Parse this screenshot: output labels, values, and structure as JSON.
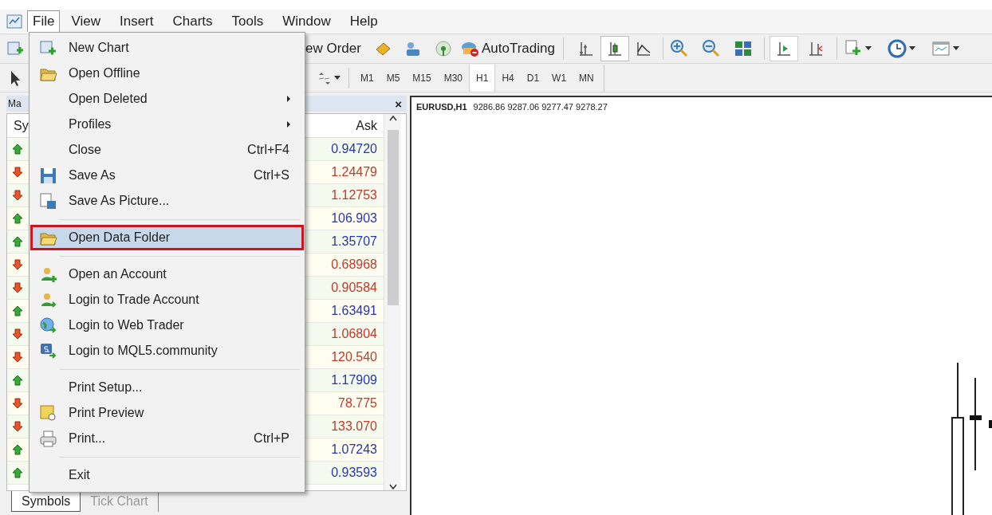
{
  "menu_bar": [
    {
      "label": "File",
      "selected": true
    },
    {
      "label": "View",
      "selected": false
    },
    {
      "label": "Insert",
      "selected": false
    },
    {
      "label": "Charts",
      "selected": false
    },
    {
      "label": "Tools",
      "selected": false
    },
    {
      "label": "Window",
      "selected": false
    },
    {
      "label": "Help",
      "selected": false
    }
  ],
  "toolbar": {
    "new_order_label": "ew Order",
    "autotrading_label": "AutoTrading",
    "chart_types": [
      {
        "selected": false
      },
      {
        "selected": true
      },
      {
        "selected": false
      }
    ]
  },
  "timeframes": [
    {
      "label": "M1",
      "selected": false
    },
    {
      "label": "M5",
      "selected": false
    },
    {
      "label": "M15",
      "selected": false
    },
    {
      "label": "M30",
      "selected": false
    },
    {
      "label": "H1",
      "selected": true
    },
    {
      "label": "H4",
      "selected": false
    },
    {
      "label": "D1",
      "selected": false
    },
    {
      "label": "W1",
      "selected": false
    },
    {
      "label": "MN",
      "selected": false
    }
  ],
  "market_watch": {
    "title": "Ma",
    "close": "×",
    "columns": [
      "Sy",
      "Ask"
    ],
    "rows": [
      {
        "kind": "up",
        "ask": "0.94720"
      },
      {
        "kind": "down",
        "ask": "1.24479"
      },
      {
        "kind": "down",
        "ask": "1.12753"
      },
      {
        "kind": "up",
        "ask": "106.903"
      },
      {
        "kind": "up",
        "ask": "1.35707"
      },
      {
        "kind": "down",
        "ask": "0.68968"
      },
      {
        "kind": "down",
        "ask": "0.90584"
      },
      {
        "kind": "up",
        "ask": "1.63491"
      },
      {
        "kind": "down",
        "ask": "1.06804"
      },
      {
        "kind": "down",
        "ask": "120.540"
      },
      {
        "kind": "up",
        "ask": "1.17909"
      },
      {
        "kind": "down",
        "ask": "78.775"
      },
      {
        "kind": "down",
        "ask": "133.070"
      },
      {
        "kind": "up",
        "ask": "1.07243"
      },
      {
        "kind": "up",
        "ask": "0.93593"
      }
    ]
  },
  "bottom_tabs": [
    {
      "label": "Symbols",
      "selected": true
    },
    {
      "label": "Tick Chart",
      "selected": false
    }
  ],
  "chart": {
    "symbol": "EURUSD,H1",
    "prices": "9286.86 9287.06 9277.47 9278.27"
  },
  "file_menu": [
    {
      "kind": "item",
      "label": "New Chart",
      "submenu": false,
      "selected": false
    },
    {
      "kind": "item",
      "label": "Open Offline",
      "submenu": false,
      "selected": false
    },
    {
      "kind": "item",
      "label": "Open Deleted",
      "submenu": true,
      "selected": false
    },
    {
      "kind": "item",
      "label": "Profiles",
      "submenu": true,
      "selected": false
    },
    {
      "kind": "item",
      "label": "Close",
      "shortcut": "Ctrl+F4",
      "submenu": false,
      "selected": false
    },
    {
      "kind": "item",
      "label": "Save As",
      "shortcut": "Ctrl+S",
      "submenu": false,
      "selected": false
    },
    {
      "kind": "item",
      "label": "Save As Picture...",
      "submenu": false,
      "selected": false
    },
    {
      "kind": "separator"
    },
    {
      "kind": "item",
      "label": "Open Data Folder",
      "submenu": false,
      "selected": true
    },
    {
      "kind": "separator"
    },
    {
      "kind": "item",
      "label": "Open an Account",
      "submenu": false,
      "selected": false
    },
    {
      "kind": "item",
      "label": "Login to Trade Account",
      "submenu": false,
      "selected": false
    },
    {
      "kind": "item",
      "label": "Login to Web Trader",
      "submenu": false,
      "selected": false
    },
    {
      "kind": "item",
      "label": "Login to MQL5.community",
      "submenu": false,
      "selected": false
    },
    {
      "kind": "separator"
    },
    {
      "kind": "item",
      "label": "Print Setup...",
      "submenu": false,
      "selected": false
    },
    {
      "kind": "item",
      "label": "Print Preview",
      "submenu": false,
      "selected": false
    },
    {
      "kind": "item",
      "label": "Print...",
      "shortcut": "Ctrl+P",
      "submenu": false,
      "selected": false
    },
    {
      "kind": "separator"
    },
    {
      "kind": "item",
      "label": "Exit",
      "submenu": false,
      "selected": false
    }
  ]
}
